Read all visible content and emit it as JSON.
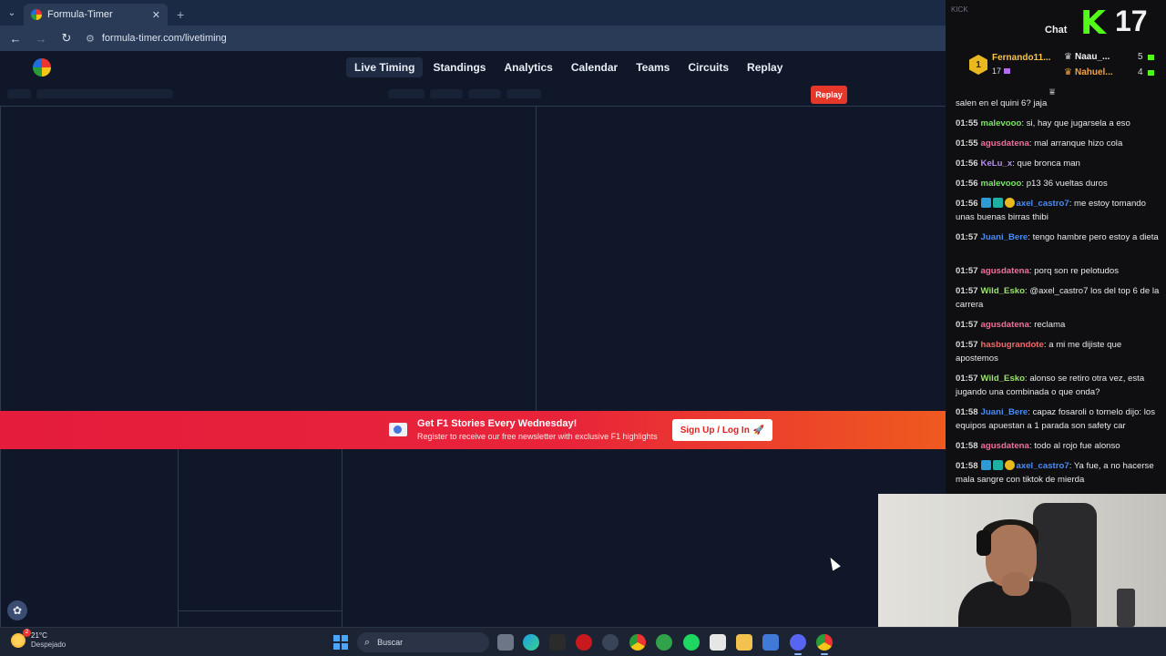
{
  "browser": {
    "tab_title": "Formula-Timer",
    "tab_close": "✕",
    "new_tab": "+",
    "back": "←",
    "forward": "→",
    "reload": "↻",
    "url": "formula-timer.com/livetiming",
    "tab_dropdown": "⌄",
    "site_settings": "⚙"
  },
  "site": {
    "nav": [
      "Live Timing",
      "Standings",
      "Analytics",
      "Calendar",
      "Teams",
      "Circuits",
      "Replay"
    ],
    "active_nav": "Live Timing",
    "replay_button": "Replay"
  },
  "banner": {
    "title": "Get F1 Stories Every Wednesday!",
    "subtitle": "Register to receive our free newsletter with exclusive F1 highlights",
    "button": "Sign Up / Log In",
    "button_icon": "🚀",
    "gradient_start": "#e51c3c",
    "gradient_end": "#ef5a1f"
  },
  "chat": {
    "platform_label": "KICK",
    "title": "Chat",
    "logo": "K",
    "viewer_count": "17",
    "top_gifter": {
      "rank": "1",
      "name": "Fernando11...",
      "count": "17"
    },
    "leaderboard": [
      {
        "name": "Naau_...",
        "count": "5",
        "color": "#f1f1f1",
        "icon": "♛"
      },
      {
        "name": "Nahuel...",
        "count": "4",
        "color": "#f5a142",
        "icon": "♛"
      }
    ],
    "filter_icon": "⩸",
    "messages": [
      {
        "time": "",
        "user": "",
        "color": "#e8e8e8",
        "text": "salen en el quini 6? jaja",
        "badges": []
      },
      {
        "time": "01:55",
        "user": "malevooo",
        "color": "#7ee36a",
        "text": "si, hay que jugarsela a eso",
        "badges": []
      },
      {
        "time": "01:55",
        "user": "agusdatena",
        "color": "#f0709a",
        "text": "mal arranque hizo cola",
        "badges": []
      },
      {
        "time": "01:56",
        "user": "KeLu_x",
        "color": "#b58cf0",
        "text": "que bronca man",
        "badges": []
      },
      {
        "time": "01:56",
        "user": "malevooo",
        "color": "#7ee36a",
        "text": "p13 36 vueltas duros",
        "badges": []
      },
      {
        "time": "01:56",
        "user": "axel_castro7",
        "color": "#4b8cf0",
        "text": "me estoy tomando unas buenas birras thibi",
        "badges": [
          "blue",
          "teal",
          "coin"
        ]
      },
      {
        "time": "01:57",
        "user": "Juani_Bere",
        "color": "#4b8cf0",
        "text": "tengo hambre pero estoy a dieta",
        "badges": []
      },
      {
        "time": "01:57",
        "user": "agusdatena",
        "color": "#f0709a",
        "text": "porq son re pelotudos",
        "badges": []
      },
      {
        "time": "01:57",
        "user": "Wild_Esko",
        "color": "#9be36a",
        "text": "@axel_castro7 los del top 6 de la carrera",
        "badges": []
      },
      {
        "time": "01:57",
        "user": "agusdatena",
        "color": "#f0709a",
        "text": "reclama",
        "badges": []
      },
      {
        "time": "01:57",
        "user": "hasbugrandote",
        "color": "#f06a6a",
        "text": "a mi me dijiste que apostemos",
        "badges": []
      },
      {
        "time": "01:57",
        "user": "Wild_Esko",
        "color": "#9be36a",
        "text": "alonso se retiro otra vez, esta jugando una combinada o que onda?",
        "badges": []
      },
      {
        "time": "01:58",
        "user": "Juani_Bere",
        "color": "#4b8cf0",
        "text": "capaz fosaroli o tornelo dijo: los equipos apuestan a 1 parada son safety car",
        "badges": []
      },
      {
        "time": "01:58",
        "user": "agusdatena",
        "color": "#f0709a",
        "text": "todo al rojo fue alonso",
        "badges": []
      },
      {
        "time": "01:58",
        "user": "axel_castro7",
        "color": "#4b8cf0",
        "text": "Ya fue, a no hacerse mala sangre con tiktok de mierda",
        "badges": [
          "blue",
          "teal",
          "coin"
        ]
      }
    ]
  },
  "taskbar": {
    "temperature": "21°C",
    "condition": "Despejado",
    "search_placeholder": "Buscar",
    "search_icon": "⌕",
    "weather_icon": "sun-icon"
  },
  "colors": {
    "page_bg": "#0f1729",
    "panel_border": "#2d3a52",
    "kick_green": "#53fc18",
    "replay_red": "#e5372a"
  }
}
